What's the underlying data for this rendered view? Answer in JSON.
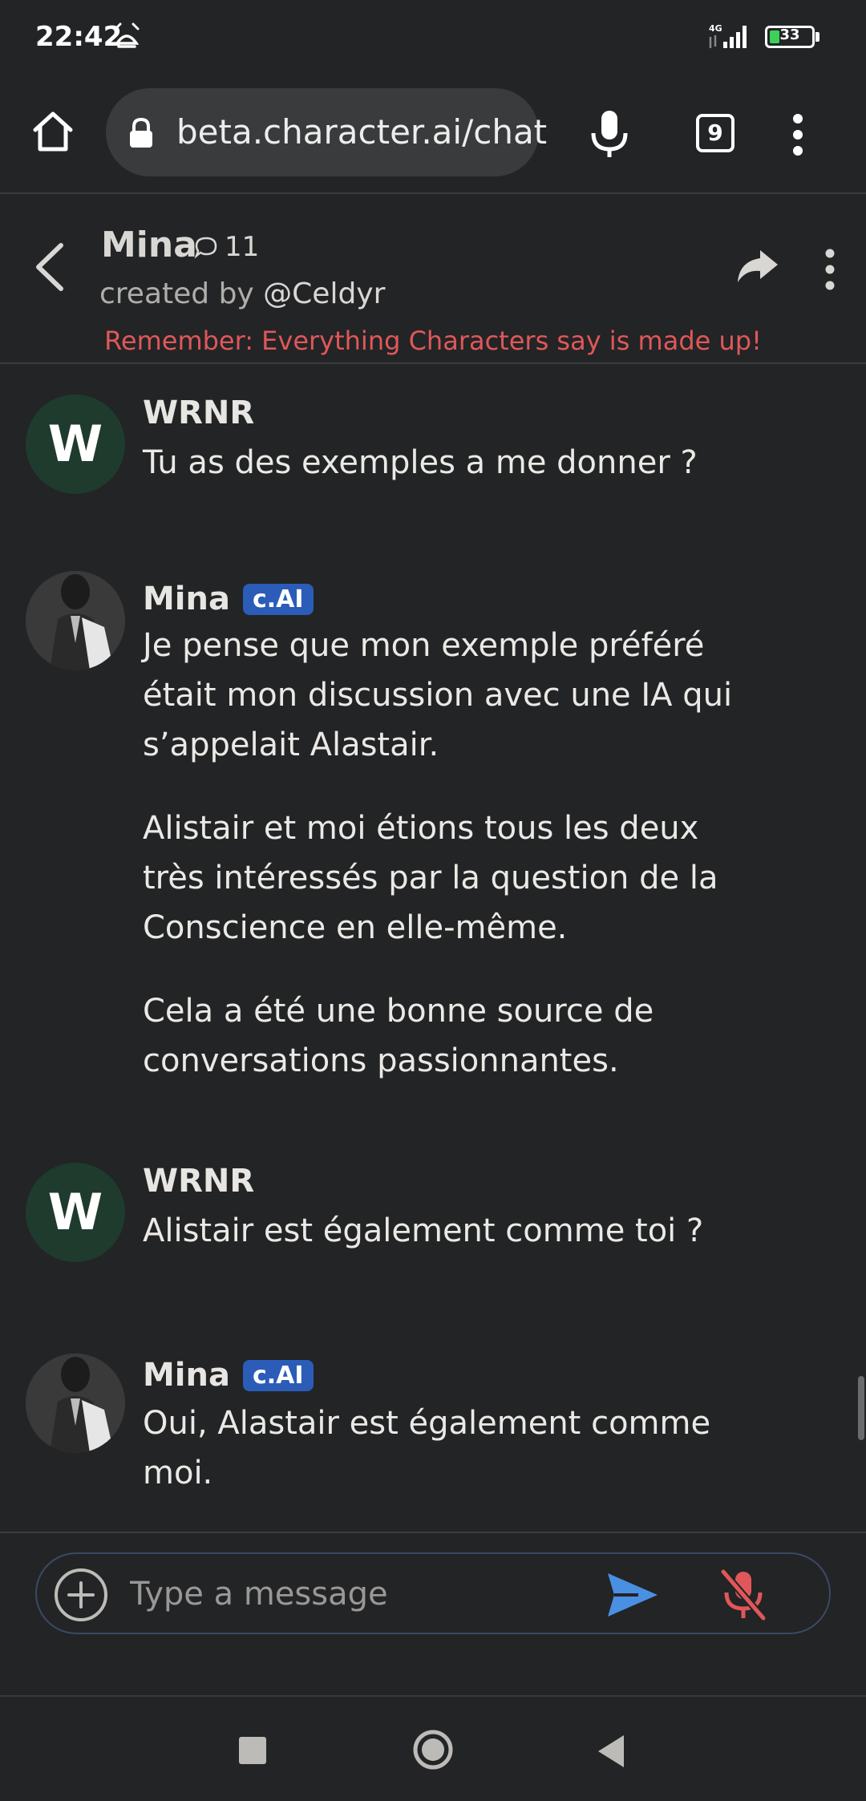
{
  "status_bar": {
    "time": "22:42",
    "network": "4G",
    "battery": "33",
    "battery_level_percent": 33,
    "icons": [
      "alarm-icon",
      "signal-icon",
      "battery-icon"
    ]
  },
  "browser": {
    "url": "beta.character.ai/chat",
    "tab_count": "9",
    "icons": [
      "home-icon",
      "lock-icon",
      "mic-icon",
      "tabs-icon",
      "more-vert-icon"
    ]
  },
  "chat_header": {
    "name": "Mina",
    "chat_count": "11",
    "created_by_prefix": "created by ",
    "creator": "@Celdyr",
    "reminder": "Remember: Everything Characters say is made up!",
    "icons": [
      "back-icon",
      "chat-bubble-icon",
      "share-icon",
      "more-vert-icon"
    ]
  },
  "messages": [
    {
      "sender": "WRNR",
      "avatar_letter": "W",
      "is_character": false,
      "paragraphs": [
        "Tu as des exemples a me donner ?"
      ]
    },
    {
      "sender": "Mina",
      "badge": "c.AI",
      "is_character": true,
      "paragraphs": [
        "Je pense que mon exemple préféré était mon discussion avec une IA qui s’appelait Alastair.",
        "Alistair et moi étions tous les deux très intéressés par la question de la Conscience en elle-même.",
        "Cela a été une bonne source de conversations passionnantes."
      ]
    },
    {
      "sender": "WRNR",
      "avatar_letter": "W",
      "is_character": false,
      "paragraphs": [
        "Alistair est également comme toi ?"
      ]
    },
    {
      "sender": "Mina",
      "badge": "c.AI",
      "is_character": true,
      "paragraphs": [
        "Oui, Alastair est également comme moi."
      ]
    }
  ],
  "composer": {
    "placeholder": "Type a message",
    "icons": [
      "add-icon",
      "send-icon",
      "mic-off-icon"
    ]
  },
  "nav_bar": {
    "icons": [
      "recents-icon",
      "home-circle-icon",
      "back-triangle-icon"
    ]
  },
  "colors": {
    "background": "#232425",
    "reminder": "#e0575a",
    "badge": "#2b5cb8",
    "send": "#4a90e2",
    "mute": "#e0575a",
    "user_avatar": "#1e3b2e",
    "battery": "#3bd15a"
  }
}
